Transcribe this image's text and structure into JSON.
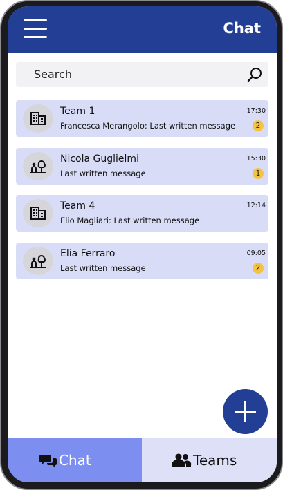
{
  "header": {
    "title": "Chat"
  },
  "search": {
    "placeholder": "Search"
  },
  "chats": [
    {
      "name": "Team 1",
      "message": "Francesca Merangolo: Last written message",
      "time": "17:30",
      "badge": "2",
      "avatar_icon": "building-icon"
    },
    {
      "name": "Nicola Guglielmi",
      "message": "Last written message",
      "time": "15:30",
      "badge": "1",
      "avatar_icon": "person-tree-icon"
    },
    {
      "name": "Team 4",
      "message": "Elio Magliari: Last written message",
      "time": "12:14",
      "badge": "",
      "avatar_icon": "building-icon"
    },
    {
      "name": "Elia Ferraro",
      "message": "Last written message",
      "time": "09:05",
      "badge": "2",
      "avatar_icon": "person-tree-icon"
    }
  ],
  "fab": {
    "icon": "plus-icon"
  },
  "tabs": [
    {
      "label": "Chat",
      "icon": "chat-bubbles-icon",
      "active": true
    },
    {
      "label": "Teams",
      "icon": "people-icon",
      "active": false
    }
  ],
  "colors": {
    "primary": "#233f95",
    "item_background": "#d9dcf6",
    "badge": "#f5c242",
    "active_tab": "#7c8ff0",
    "inactive_tab": "#dde0f7"
  }
}
